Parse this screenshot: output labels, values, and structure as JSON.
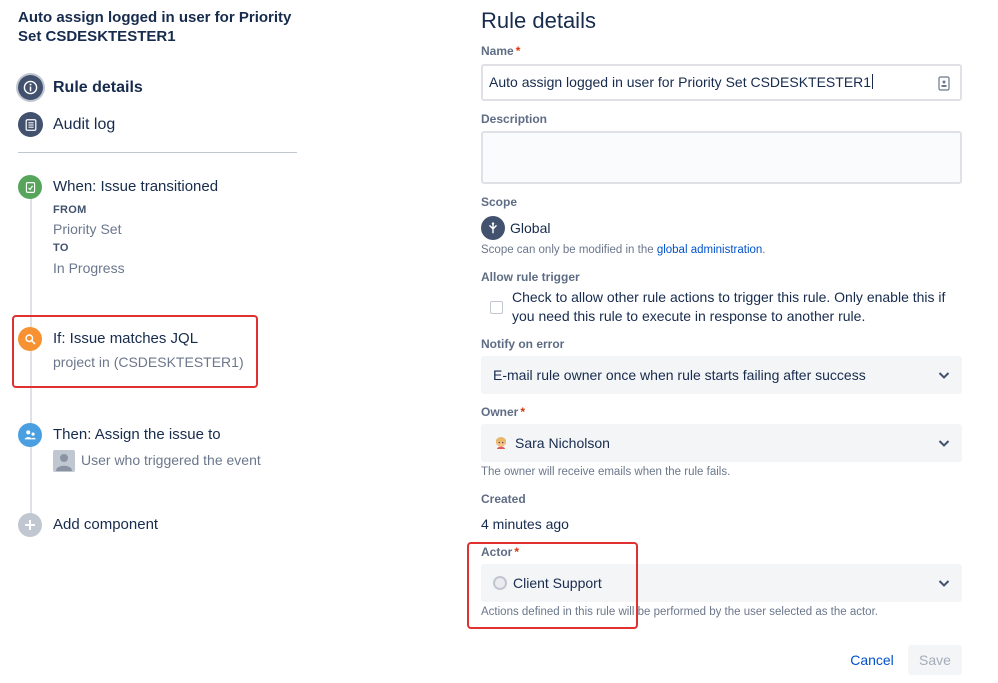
{
  "rule": {
    "title": "Auto assign logged in user for Priority Set CSDESKTESTER1"
  },
  "nav": {
    "rule_details": "Rule details",
    "audit_log": "Audit log"
  },
  "components": {
    "trigger": {
      "title": "When: Issue transitioned",
      "from_label": "FROM",
      "from_value": "Priority Set",
      "to_label": "TO",
      "to_value": "In Progress",
      "icon": "trigger-icon",
      "color": "#57a55a"
    },
    "condition": {
      "title": "If: Issue matches JQL",
      "value": "project in (CSDESKTESTER1)",
      "icon": "search-icon",
      "color": "#f79232"
    },
    "action": {
      "title": "Then: Assign the issue to",
      "value": "User who triggered the event",
      "icon": "assign-user-icon",
      "color": "#4a9fe0"
    },
    "add": {
      "label": "Add component",
      "color": "#c1c7d0"
    }
  },
  "form": {
    "heading": "Rule details",
    "name": {
      "label": "Name",
      "required": "*",
      "value": "Auto assign logged in user for Priority Set CSDESKTESTER1"
    },
    "description": {
      "label": "Description",
      "value": ""
    },
    "scope": {
      "label": "Scope",
      "value": "Global",
      "helper_prefix": "Scope can only be modified in the ",
      "helper_link": "global administration",
      "helper_suffix": "."
    },
    "allow_trigger": {
      "label": "Allow rule trigger",
      "checkbox_label": "Check to allow other rule actions to trigger this rule. Only enable this if you need this rule to execute in response to another rule.",
      "checked": false
    },
    "notify": {
      "label": "Notify on error",
      "value": "E-mail rule owner once when rule starts failing after success"
    },
    "owner": {
      "label": "Owner",
      "required": "*",
      "value": "Sara Nicholson",
      "helper": "The owner will receive emails when the rule fails."
    },
    "created": {
      "label": "Created",
      "value": "4 minutes ago"
    },
    "actor": {
      "label": "Actor",
      "required": "*",
      "value": "Client Support",
      "helper": "Actions defined in this rule will be performed by the user selected as the actor."
    }
  },
  "buttons": {
    "cancel": "Cancel",
    "save": "Save"
  },
  "colors": {
    "highlight": "#e03030",
    "link": "#0052cc",
    "nav_active": "#42526e"
  }
}
